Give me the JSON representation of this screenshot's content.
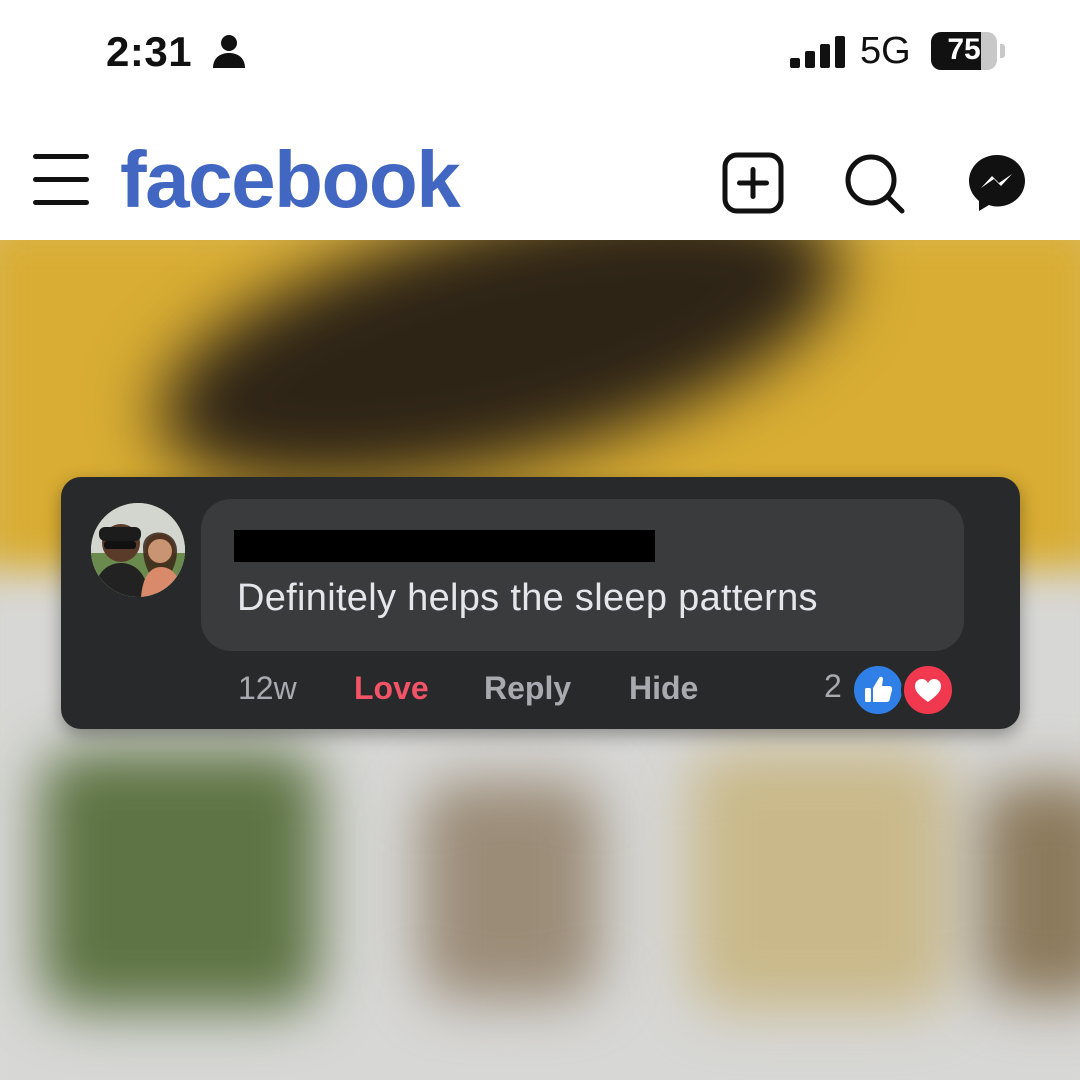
{
  "status_bar": {
    "time": "2:31",
    "person_icon": "person-icon",
    "signal_icon": "signal-bars-icon",
    "network": "5G",
    "battery_percent": "75",
    "battery_level": 0.75
  },
  "topbar": {
    "logo": "facebook",
    "menu_icon": "hamburger-menu-icon",
    "create_icon": "plus-square-icon",
    "search_icon": "search-icon",
    "messenger_icon": "messenger-icon",
    "brand_color": "#4267c2"
  },
  "comment": {
    "author_redacted": true,
    "text": "Definitely helps the sleep patterns",
    "actions": {
      "time": "12w",
      "love": "Love",
      "reply": "Reply",
      "hide": "Hide"
    },
    "reactions": {
      "count": "2",
      "types": [
        "like",
        "love"
      ]
    },
    "love_color": "#f25366"
  }
}
